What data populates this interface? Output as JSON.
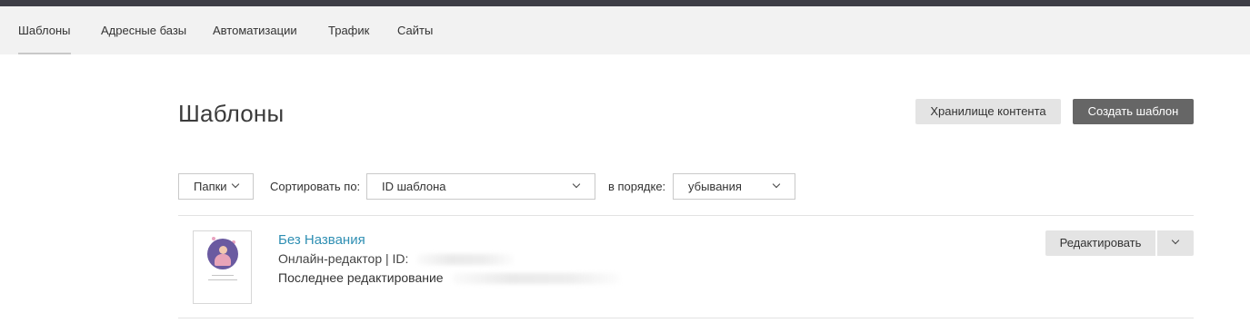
{
  "nav": {
    "tabs": [
      {
        "label": "Шаблоны",
        "active": true
      },
      {
        "label": "Адресные базы",
        "active": false
      },
      {
        "label": "Автоматизации",
        "active": false
      },
      {
        "label": "Трафик",
        "active": false
      },
      {
        "label": "Сайты",
        "active": false
      }
    ]
  },
  "page": {
    "title": "Шаблоны",
    "storage_button": "Хранилище контента",
    "create_button": "Создать шаблон"
  },
  "filters": {
    "folders_label": "Папки",
    "sort_label": "Сортировать по:",
    "sort_value": "ID шаблона",
    "order_label": "в порядке:",
    "order_value": "убывания"
  },
  "templates": [
    {
      "name": "Без Названия",
      "meta": "Онлайн-редактор | ID:",
      "edited_label": "Последнее редактирование",
      "edit_button": "Редактировать"
    }
  ],
  "colors": {
    "topbar": "#3e3e46",
    "subnav_bg": "#f2f2f2",
    "primary_button": "#666666",
    "secondary_button": "#e4e4e4",
    "link": "#2f8fb3"
  },
  "icons": {
    "dropdown": "chevron-down-icon"
  }
}
